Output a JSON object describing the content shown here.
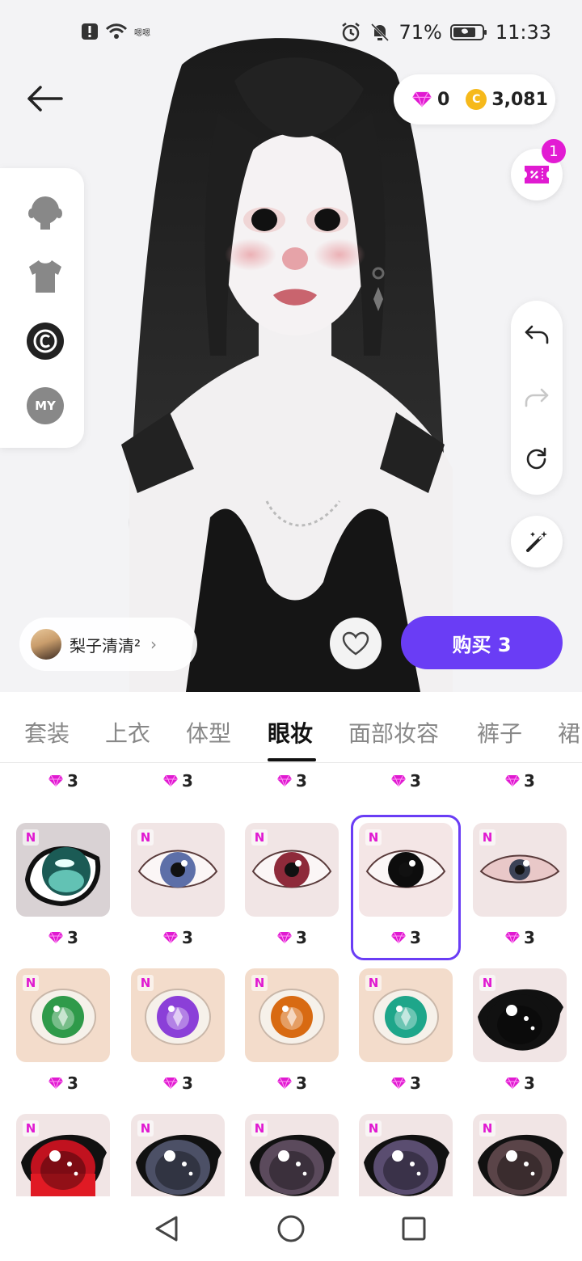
{
  "status_bar": {
    "network_text": "嗯嗯",
    "battery": "71%",
    "time": "11:33"
  },
  "header": {
    "gems": "0",
    "coins": "3,081",
    "coupon_badge": "1",
    "coin_symbol": "C"
  },
  "left_panel": {
    "items": [
      {
        "icon": "head-icon"
      },
      {
        "icon": "shirt-icon"
      },
      {
        "icon": "copyright-icon"
      },
      {
        "icon": "my-icon",
        "label": "MY"
      }
    ]
  },
  "creator": {
    "name": "梨子清清²",
    "chevron": "›"
  },
  "buy_button": "购买 3",
  "tabs": [
    {
      "label": "套装"
    },
    {
      "label": "上衣"
    },
    {
      "label": "体型"
    },
    {
      "label": "眼妆",
      "active": true
    },
    {
      "label": "面部妆容"
    },
    {
      "label": "裤子"
    },
    {
      "label": "裙"
    }
  ],
  "grid": {
    "badge": "N",
    "rows": [
      {
        "prices": [
          "3",
          "3",
          "3",
          "3",
          "3"
        ],
        "partial": true
      },
      {
        "prices": [
          "3",
          "3",
          "3",
          "3",
          "3"
        ],
        "selected_index": 3
      },
      {
        "prices": [
          "3",
          "3",
          "3",
          "3",
          "3"
        ]
      },
      {
        "prices": [
          "",
          "",
          "",
          "",
          ""
        ]
      }
    ]
  },
  "colors": {
    "accent": "#6a3df5",
    "gem": "#e01ad1",
    "coin": "#f6b91b"
  }
}
